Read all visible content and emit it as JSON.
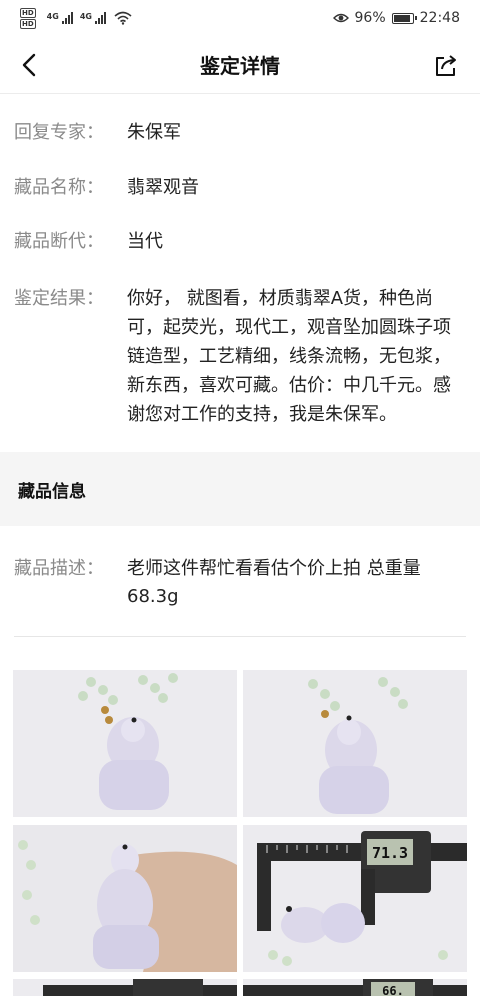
{
  "status_bar": {
    "hd1": "HD",
    "hd2": "HD",
    "net1": "4G",
    "net2": "4G",
    "battery_percent": "96%",
    "battery_level": 0.96,
    "time": "22:48"
  },
  "nav": {
    "title": "鉴定详情"
  },
  "details": [
    {
      "label": "回复专家：",
      "value": "朱保军"
    },
    {
      "label": "藏品名称：",
      "value": "翡翠观音"
    },
    {
      "label": "藏品断代：",
      "value": "当代"
    },
    {
      "label": "鉴定结果：",
      "value": "你好，  就图看，材质翡翠A货，种色尚可，起荧光，现代工，观音坠加圆珠子项链造型，工艺精细，线条流畅，无包浆，新东西，喜欢可藏。估价：中几千元。感谢您对工作的支持，我是朱保军。"
    }
  ],
  "collection_info": {
    "section_title": "藏品信息",
    "description_label": "藏品描述：",
    "description_value": "老师这件帮忙看看估个价上拍 总重量68.3g"
  },
  "photos": {
    "caliper_reading": "71.3",
    "caliper_reading_2": "66."
  }
}
